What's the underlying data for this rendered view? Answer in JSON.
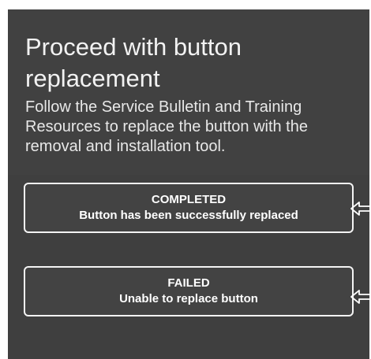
{
  "screen": {
    "title": "Proceed with button replacement",
    "instructions": "Follow the Service Bulletin and Training Resources to replace the button with the removal and installation tool."
  },
  "options": [
    {
      "status": "COMPLETED",
      "description": "Button has been successfully replaced"
    },
    {
      "status": "FAILED",
      "description": "Unable to replace button"
    }
  ],
  "colors": {
    "panel_background": "#414141",
    "text": "#f2f2f2",
    "button_border": "#f4f4f4"
  },
  "icons": [
    "pointer-arrow-icon",
    "pointer-arrow-icon"
  ]
}
